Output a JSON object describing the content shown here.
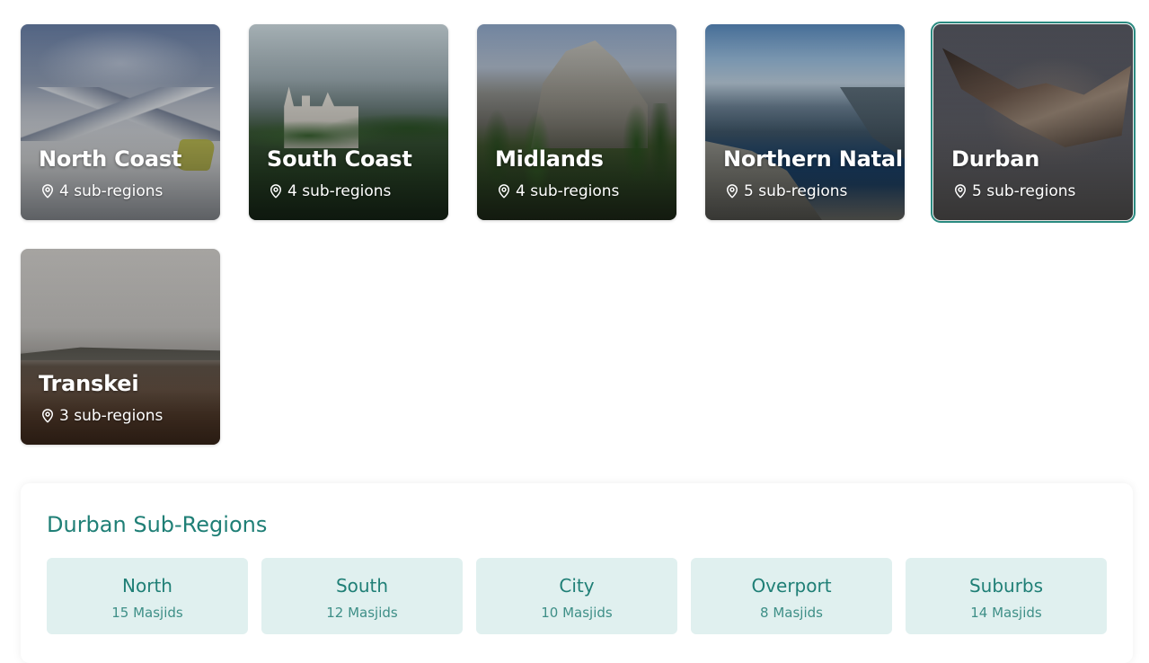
{
  "regions": [
    {
      "name": "North Coast",
      "sub_count": "4 sub-regions",
      "icon": "location-pin-icon",
      "selected": false
    },
    {
      "name": "South Coast",
      "sub_count": "4 sub-regions",
      "icon": "location-pin-icon",
      "selected": false
    },
    {
      "name": "Midlands",
      "sub_count": "4 sub-regions",
      "icon": "location-pin-icon",
      "selected": false
    },
    {
      "name": "Northern Natal",
      "sub_count": "5 sub-regions",
      "icon": "location-pin-icon",
      "selected": false
    },
    {
      "name": "Durban",
      "sub_count": "5 sub-regions",
      "icon": "location-pin-icon",
      "selected": true
    },
    {
      "name": "Transkei",
      "sub_count": "3 sub-regions",
      "icon": "location-pin-icon",
      "selected": false
    }
  ],
  "subregions_panel": {
    "title": "Durban Sub-Regions",
    "items": [
      {
        "name": "North",
        "count": "15 Masjids"
      },
      {
        "name": "South",
        "count": "12 Masjids"
      },
      {
        "name": "City",
        "count": "10 Masjids"
      },
      {
        "name": "Overport",
        "count": "8 Masjids"
      },
      {
        "name": "Suburbs",
        "count": "14 Masjids"
      }
    ]
  },
  "colors": {
    "accent": "#1f7f76",
    "selected_border": "#2a8a80",
    "subregion_bg": "#e0f0ef"
  }
}
